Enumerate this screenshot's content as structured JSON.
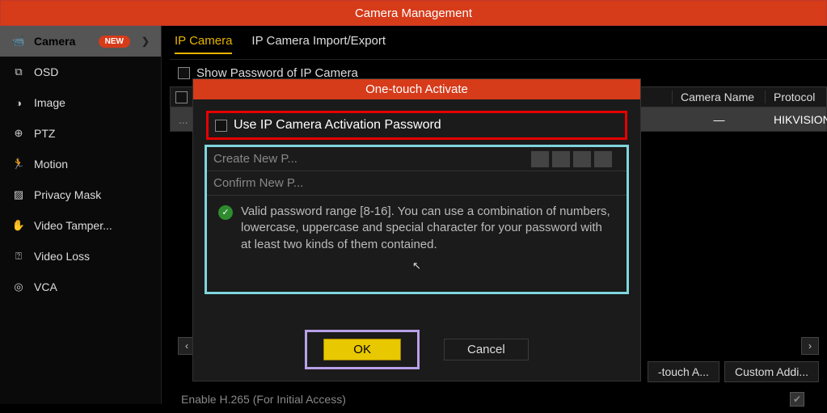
{
  "titlebar": "Camera Management",
  "sidebar": {
    "items": [
      {
        "label": "Camera",
        "badge": "NEW"
      },
      {
        "label": "OSD"
      },
      {
        "label": "Image"
      },
      {
        "label": "PTZ"
      },
      {
        "label": "Motion"
      },
      {
        "label": "Privacy Mask"
      },
      {
        "label": "Video Tamper..."
      },
      {
        "label": "Video Loss"
      },
      {
        "label": "VCA"
      }
    ]
  },
  "tabs": {
    "items": [
      {
        "label": "IP Camera"
      },
      {
        "label": "IP Camera Import/Export"
      }
    ]
  },
  "showpw_label": "Show Password of IP Camera",
  "table": {
    "headers": {
      "name": "Camera Name",
      "proto": "Protocol"
    },
    "row": {
      "name": "—",
      "proto": "HIKVISION"
    }
  },
  "bottom": {
    "onetouch": "-touch A...",
    "custom": "Custom Addi..."
  },
  "enable_label": "Enable H.265 (For Initial Access)",
  "dialog": {
    "title": "One-touch Activate",
    "useip_label": "Use IP Camera Activation Password",
    "create_label": "Create New P...",
    "confirm_label": "Confirm New P...",
    "hint": "Valid password range [8-16]. You can use a combination of numbers, lowercase, uppercase and special character for your password with at least two kinds of them contained.",
    "ok": "OK",
    "cancel": "Cancel"
  }
}
